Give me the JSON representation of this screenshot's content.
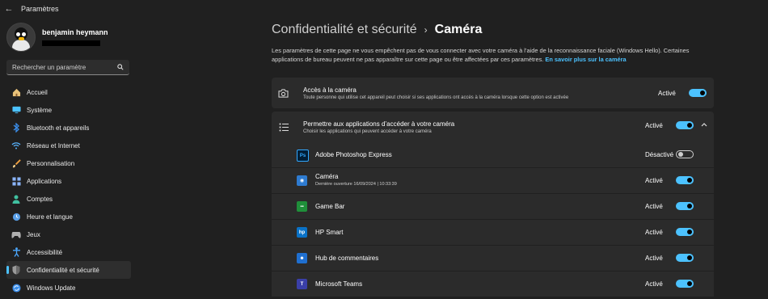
{
  "window": {
    "title": "Paramètres"
  },
  "profile": {
    "name": "benjamin heymann"
  },
  "search": {
    "placeholder": "Rechercher un paramètre"
  },
  "nav": [
    {
      "label": "Accueil",
      "icon": "home-icon",
      "color": "#e8c27a"
    },
    {
      "label": "Système",
      "icon": "display-icon",
      "color": "#4cc2ff"
    },
    {
      "label": "Bluetooth et appareils",
      "icon": "bluetooth-icon",
      "color": "#3b8eea"
    },
    {
      "label": "Réseau et Internet",
      "icon": "wifi-icon",
      "color": "#58b4ff"
    },
    {
      "label": "Personnalisation",
      "icon": "brush-icon",
      "color": "#f0a040"
    },
    {
      "label": "Applications",
      "icon": "apps-icon",
      "color": "#8ab4f8"
    },
    {
      "label": "Comptes",
      "icon": "person-icon",
      "color": "#40c0a0"
    },
    {
      "label": "Heure et langue",
      "icon": "globe-clock-icon",
      "color": "#5aa0e8"
    },
    {
      "label": "Jeux",
      "icon": "gamepad-icon",
      "color": "#b0b0b0"
    },
    {
      "label": "Accessibilité",
      "icon": "accessibility-icon",
      "color": "#4ca8ff"
    },
    {
      "label": "Confidentialité et sécurité",
      "icon": "shield-icon",
      "color": "#9a9a9a",
      "active": true
    },
    {
      "label": "Windows Update",
      "icon": "update-icon",
      "color": "#3b8eea"
    }
  ],
  "breadcrumb": {
    "parent": "Confidentialité et sécurité",
    "separator": "›",
    "current": "Caméra"
  },
  "intro": {
    "text": "Les paramètres de cette page ne vous empêchent pas de vous connecter avec votre caméra à l’aide de la reconnaissance faciale (Windows Hello). Certaines applications de bureau peuvent ne pas apparaître sur cette page ou être affectées par ces paramètres.",
    "link": "En savoir plus sur la caméra"
  },
  "camera_access": {
    "title": "Accès à la caméra",
    "subtitle": "Toute personne qui utilise cet appareil peut choisir si ses applications ont accès à la caméra lorsque cette option est activée",
    "state": "Activé",
    "on": true
  },
  "apps_access": {
    "title": "Permettre aux applications d’accéder à votre caméra",
    "subtitle": "Choisir les applications qui peuvent accéder à votre caméra",
    "state": "Activé",
    "on": true
  },
  "apps": [
    {
      "name": "Adobe Photoshop Express",
      "state": "Désactivé",
      "on": false,
      "icon": "photoshop-icon",
      "color": "#001e36",
      "glyph": "Ps"
    },
    {
      "name": "Caméra",
      "sub": "Dernière ouverture 16/09/2024  |  10:33:39",
      "state": "Activé",
      "on": true,
      "icon": "camera-app-icon",
      "color": "#2e7bd0",
      "glyph": "◉"
    },
    {
      "name": "Game Bar",
      "state": "Activé",
      "on": true,
      "icon": "game-bar-icon",
      "color": "#1f8f3a",
      "glyph": "▪▪"
    },
    {
      "name": "HP Smart",
      "state": "Activé",
      "on": true,
      "icon": "hp-smart-icon",
      "color": "#0a72c7",
      "glyph": "hp"
    },
    {
      "name": "Hub de commentaires",
      "state": "Activé",
      "on": true,
      "icon": "feedback-hub-icon",
      "color": "#1f6fd0",
      "glyph": "☻"
    },
    {
      "name": "Microsoft Teams",
      "state": "Activé",
      "on": true,
      "icon": "teams-icon",
      "color": "#3a3fa8",
      "glyph": "T"
    }
  ]
}
